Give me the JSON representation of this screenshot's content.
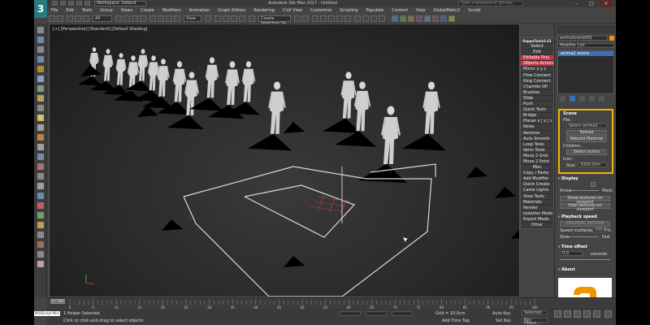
{
  "app": {
    "title": "Autodesk 3ds Max 2017 - Untitled",
    "logo": "3",
    "workspace": "Workspace: Default",
    "search_placeholder": "Type a keyword or phrase"
  },
  "menu": [
    "File",
    "Edit",
    "Tools",
    "Group",
    "Views",
    "Create",
    "Modifiers",
    "Animation",
    "Graph Editors",
    "Rendering",
    "Civil View",
    "Customize",
    "Scripting",
    "Populate",
    "Content",
    "Help",
    "GlobalMatic2",
    "Sculpt"
  ],
  "toolbar": {
    "filter_dropdown": "All",
    "view_dropdown": "View",
    "selection_set": "Create Selection Se"
  },
  "viewport": {
    "label": "[+] [Perspective] [Standard] [Default Shading]"
  },
  "quad_menu": [
    {
      "label": "RappaTools3.41",
      "type": "title"
    },
    {
      "label": "Select",
      "type": "center"
    },
    {
      "label": "Edit",
      "type": "center"
    },
    {
      "label": "Editable Poly",
      "type": "head"
    },
    {
      "label": "Objects Actions",
      "type": "head"
    },
    {
      "label": "Mirror  x  y  z",
      "type": "item"
    },
    {
      "label": "Flow Connect",
      "type": "item"
    },
    {
      "label": "Ring Connect",
      "type": "item"
    },
    {
      "label": "Chamfer OP",
      "type": "item"
    },
    {
      "label": "Brushes",
      "type": "item"
    },
    {
      "label": "Slide",
      "type": "item"
    },
    {
      "label": "Push",
      "type": "item"
    },
    {
      "label": "Quick Tools",
      "type": "item"
    },
    {
      "label": "Bridge",
      "type": "item"
    },
    {
      "label": "Planar  x | y | z",
      "type": "item"
    },
    {
      "label": "Relax",
      "type": "item"
    },
    {
      "label": "Remove",
      "type": "item"
    },
    {
      "label": "Auto Smooth",
      "type": "item"
    },
    {
      "label": "Loop Tools",
      "type": "item"
    },
    {
      "label": "Verts Tools",
      "type": "item"
    },
    {
      "label": "Move 2 Grid",
      "type": "item"
    },
    {
      "label": "Move 2 Point",
      "type": "item"
    },
    {
      "label": "Misc",
      "type": "center"
    },
    {
      "label": "Copy / Paste",
      "type": "item"
    },
    {
      "label": "Add Modifier",
      "type": "item"
    },
    {
      "label": "Quick Create",
      "type": "item"
    },
    {
      "label": "Came Lights",
      "type": "item"
    },
    {
      "label": "View Tools",
      "type": "item"
    },
    {
      "label": "Materials",
      "type": "item"
    },
    {
      "label": "Render",
      "type": "item"
    },
    {
      "label": "Isolation Mode",
      "type": "item"
    },
    {
      "label": "Export Mode",
      "type": "item"
    },
    {
      "label": "Other",
      "type": "center"
    }
  ],
  "command_panel": {
    "object_name": "animaScene001",
    "modifier_list": "Modifier List",
    "stack_item": "anima2 scene",
    "scene": {
      "header": "Scene",
      "file_label": "File:",
      "file_value": "Select anima2 ...",
      "reload": "Reload",
      "rebuild_material": "Rebuild Material",
      "children_label": "Children:",
      "select_actors": "Select actors",
      "icon_label": "Icon:",
      "size_label": "Size:",
      "size_value": "1000,0cm"
    },
    "display": {
      "header": "Display",
      "arrow_label": "Arrow",
      "mesh_label": "Mesh",
      "show_textures": "Show textures on viewport",
      "hide_textures": "Hide textures on viewport"
    },
    "playback": {
      "header": "Playback speed",
      "original_motion": "ORIGINAL MOTION",
      "speed_label": "Speed multiplier:",
      "speed_value": "100,0",
      "speed_unit": "%",
      "slow": "Slow",
      "fast": "Fast"
    },
    "time_offset": {
      "header": "Time offset",
      "value": "0,0",
      "unit": "seconds"
    },
    "about": {
      "header": "About"
    }
  },
  "timeline": {
    "slider": "0 / 100",
    "ticks": [
      "0",
      "5",
      "10",
      "15",
      "20",
      "25",
      "30",
      "35",
      "40",
      "45",
      "50",
      "55",
      "60",
      "65",
      "70",
      "75",
      "80",
      "85",
      "90",
      "95",
      "100"
    ]
  },
  "status": {
    "maxscript": "MAXScript Mini",
    "selected": "1 Helper Selected",
    "prompt": "Click or click-and-drag to select objects",
    "grid": "Grid = 10,0cm",
    "add_time_tag": "Add Time Tag",
    "auto_key": "Auto Key",
    "set_key": "Set Key",
    "selected_dropdown": "Selected",
    "key_filters": "Key Filters..."
  },
  "colors": {
    "accent_red": "#cc3044",
    "highlight_yellow": "#f0b400",
    "selection_blue": "#3d6fb6",
    "brand_orange": "#f29400"
  }
}
